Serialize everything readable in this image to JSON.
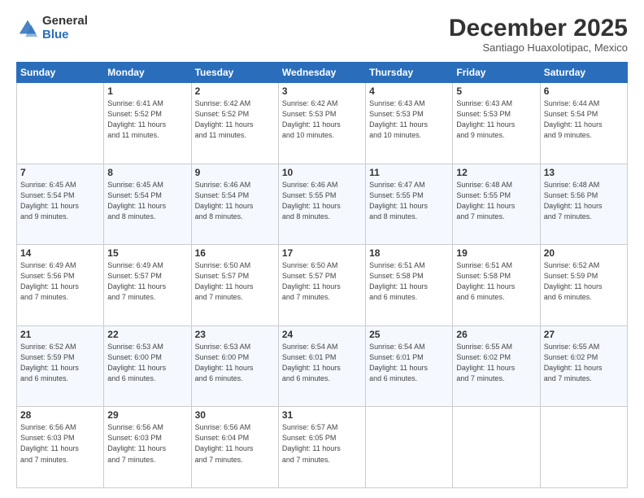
{
  "header": {
    "logo_general": "General",
    "logo_blue": "Blue",
    "month_title": "December 2025",
    "location": "Santiago Huaxolotipac, Mexico"
  },
  "days_of_week": [
    "Sunday",
    "Monday",
    "Tuesday",
    "Wednesday",
    "Thursday",
    "Friday",
    "Saturday"
  ],
  "weeks": [
    [
      {
        "day": "",
        "info": ""
      },
      {
        "day": "1",
        "info": "Sunrise: 6:41 AM\nSunset: 5:52 PM\nDaylight: 11 hours\nand 11 minutes."
      },
      {
        "day": "2",
        "info": "Sunrise: 6:42 AM\nSunset: 5:52 PM\nDaylight: 11 hours\nand 11 minutes."
      },
      {
        "day": "3",
        "info": "Sunrise: 6:42 AM\nSunset: 5:53 PM\nDaylight: 11 hours\nand 10 minutes."
      },
      {
        "day": "4",
        "info": "Sunrise: 6:43 AM\nSunset: 5:53 PM\nDaylight: 11 hours\nand 10 minutes."
      },
      {
        "day": "5",
        "info": "Sunrise: 6:43 AM\nSunset: 5:53 PM\nDaylight: 11 hours\nand 9 minutes."
      },
      {
        "day": "6",
        "info": "Sunrise: 6:44 AM\nSunset: 5:54 PM\nDaylight: 11 hours\nand 9 minutes."
      }
    ],
    [
      {
        "day": "7",
        "info": "Sunrise: 6:45 AM\nSunset: 5:54 PM\nDaylight: 11 hours\nand 9 minutes."
      },
      {
        "day": "8",
        "info": "Sunrise: 6:45 AM\nSunset: 5:54 PM\nDaylight: 11 hours\nand 8 minutes."
      },
      {
        "day": "9",
        "info": "Sunrise: 6:46 AM\nSunset: 5:54 PM\nDaylight: 11 hours\nand 8 minutes."
      },
      {
        "day": "10",
        "info": "Sunrise: 6:46 AM\nSunset: 5:55 PM\nDaylight: 11 hours\nand 8 minutes."
      },
      {
        "day": "11",
        "info": "Sunrise: 6:47 AM\nSunset: 5:55 PM\nDaylight: 11 hours\nand 8 minutes."
      },
      {
        "day": "12",
        "info": "Sunrise: 6:48 AM\nSunset: 5:55 PM\nDaylight: 11 hours\nand 7 minutes."
      },
      {
        "day": "13",
        "info": "Sunrise: 6:48 AM\nSunset: 5:56 PM\nDaylight: 11 hours\nand 7 minutes."
      }
    ],
    [
      {
        "day": "14",
        "info": "Sunrise: 6:49 AM\nSunset: 5:56 PM\nDaylight: 11 hours\nand 7 minutes."
      },
      {
        "day": "15",
        "info": "Sunrise: 6:49 AM\nSunset: 5:57 PM\nDaylight: 11 hours\nand 7 minutes."
      },
      {
        "day": "16",
        "info": "Sunrise: 6:50 AM\nSunset: 5:57 PM\nDaylight: 11 hours\nand 7 minutes."
      },
      {
        "day": "17",
        "info": "Sunrise: 6:50 AM\nSunset: 5:57 PM\nDaylight: 11 hours\nand 7 minutes."
      },
      {
        "day": "18",
        "info": "Sunrise: 6:51 AM\nSunset: 5:58 PM\nDaylight: 11 hours\nand 6 minutes."
      },
      {
        "day": "19",
        "info": "Sunrise: 6:51 AM\nSunset: 5:58 PM\nDaylight: 11 hours\nand 6 minutes."
      },
      {
        "day": "20",
        "info": "Sunrise: 6:52 AM\nSunset: 5:59 PM\nDaylight: 11 hours\nand 6 minutes."
      }
    ],
    [
      {
        "day": "21",
        "info": "Sunrise: 6:52 AM\nSunset: 5:59 PM\nDaylight: 11 hours\nand 6 minutes."
      },
      {
        "day": "22",
        "info": "Sunrise: 6:53 AM\nSunset: 6:00 PM\nDaylight: 11 hours\nand 6 minutes."
      },
      {
        "day": "23",
        "info": "Sunrise: 6:53 AM\nSunset: 6:00 PM\nDaylight: 11 hours\nand 6 minutes."
      },
      {
        "day": "24",
        "info": "Sunrise: 6:54 AM\nSunset: 6:01 PM\nDaylight: 11 hours\nand 6 minutes."
      },
      {
        "day": "25",
        "info": "Sunrise: 6:54 AM\nSunset: 6:01 PM\nDaylight: 11 hours\nand 6 minutes."
      },
      {
        "day": "26",
        "info": "Sunrise: 6:55 AM\nSunset: 6:02 PM\nDaylight: 11 hours\nand 7 minutes."
      },
      {
        "day": "27",
        "info": "Sunrise: 6:55 AM\nSunset: 6:02 PM\nDaylight: 11 hours\nand 7 minutes."
      }
    ],
    [
      {
        "day": "28",
        "info": "Sunrise: 6:56 AM\nSunset: 6:03 PM\nDaylight: 11 hours\nand 7 minutes."
      },
      {
        "day": "29",
        "info": "Sunrise: 6:56 AM\nSunset: 6:03 PM\nDaylight: 11 hours\nand 7 minutes."
      },
      {
        "day": "30",
        "info": "Sunrise: 6:56 AM\nSunset: 6:04 PM\nDaylight: 11 hours\nand 7 minutes."
      },
      {
        "day": "31",
        "info": "Sunrise: 6:57 AM\nSunset: 6:05 PM\nDaylight: 11 hours\nand 7 minutes."
      },
      {
        "day": "",
        "info": ""
      },
      {
        "day": "",
        "info": ""
      },
      {
        "day": "",
        "info": ""
      }
    ]
  ]
}
